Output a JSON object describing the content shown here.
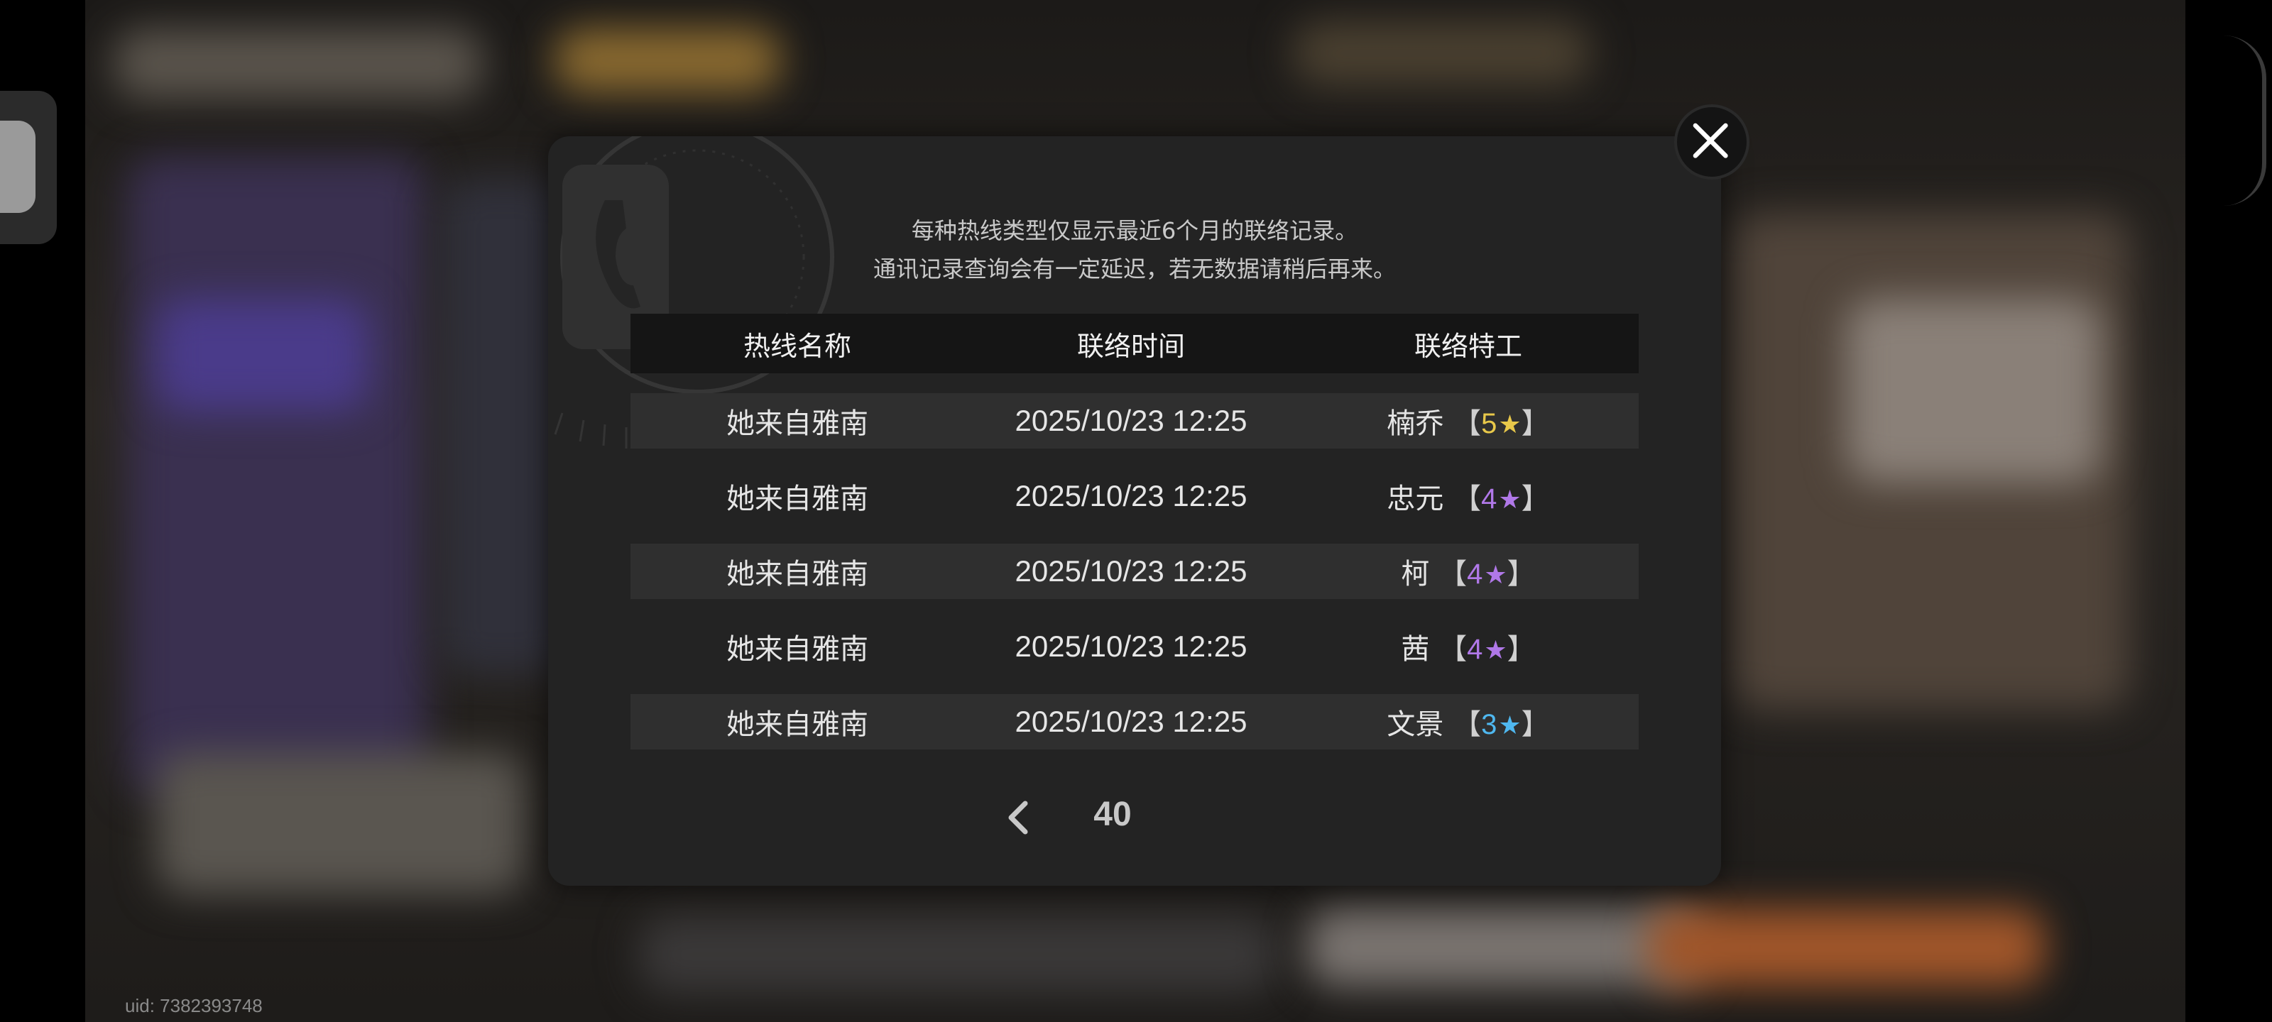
{
  "background": {
    "uid_label": "uid: 7382393748"
  },
  "dialog": {
    "notice_line1": "每种热线类型仅显示最近6个月的联络记录。",
    "notice_line2": "通讯记录查询会有一定延迟，若无数据请稍后再来。",
    "table": {
      "headers": [
        "热线名称",
        "联络时间",
        "联络特工"
      ],
      "rows": [
        {
          "hotline": "她来自雅南",
          "time": "2025/10/23 12:25",
          "agent": "楠乔",
          "rank": "5",
          "rank_color": "#e8c84a"
        },
        {
          "hotline": "她来自雅南",
          "time": "2025/10/23 12:25",
          "agent": "忠元",
          "rank": "4",
          "rank_color": "#b078e8"
        },
        {
          "hotline": "她来自雅南",
          "time": "2025/10/23 12:25",
          "agent": "柯",
          "rank": "4",
          "rank_color": "#b078e8"
        },
        {
          "hotline": "她来自雅南",
          "time": "2025/10/23 12:25",
          "agent": "茜",
          "rank": "4",
          "rank_color": "#b078e8"
        },
        {
          "hotline": "她来自雅南",
          "time": "2025/10/23 12:25",
          "agent": "文景",
          "rank": "3",
          "rank_color": "#4fb8f0"
        }
      ],
      "rank_open": "【",
      "rank_close": "】"
    },
    "pager": {
      "page_number": "40",
      "prev_icon": "chevron-left-icon"
    },
    "close_icon": "close-icon"
  }
}
